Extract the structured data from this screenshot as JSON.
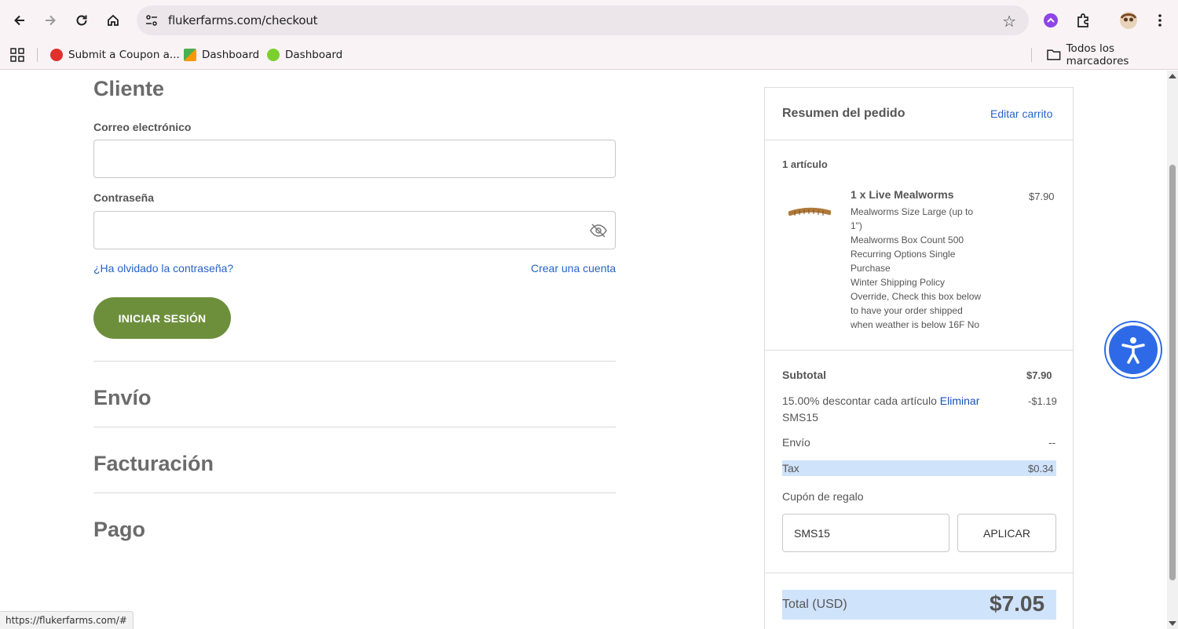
{
  "browser": {
    "url": "flukerfarms.com/checkout",
    "bookmarks": [
      "Submit a Coupon a...",
      "Dashboard",
      "Dashboard"
    ],
    "all_bookmarks": "Todos los marcadores",
    "status_url": "https://flukerfarms.com/#"
  },
  "customer": {
    "heading": "Cliente",
    "email_label": "Correo electrónico",
    "password_label": "Contraseña",
    "forgot_link": "¿Ha olvidado la contraseña?",
    "create_link": "Crear una cuenta",
    "login_button": "INICIAR SESIÓN"
  },
  "sections": {
    "shipping": "Envío",
    "billing": "Facturación",
    "payment": "Pago"
  },
  "summary": {
    "title": "Resumen del pedido",
    "edit_cart": "Editar carrito",
    "item_count": "1 artículo",
    "item": {
      "name": "1 x Live Mealworms",
      "price": "$7.90",
      "details": [
        "Mealworms Size Large (up to",
        "1\")",
        "Mealworms Box Count 500",
        "Recurring Options Single",
        "Purchase",
        "Winter Shipping Policy",
        "Override, Check this box below",
        "to have your order shipped",
        "when weather is below 16F No"
      ]
    },
    "subtotal_label": "Subtotal",
    "subtotal_value": "$7.90",
    "discount_label": "15.00% descontar cada artículo",
    "discount_remove": "Eliminar",
    "discount_code": "SMS15",
    "discount_value": "-$1.19",
    "shipping_label": "Envío",
    "shipping_value": "--",
    "tax_label": "Tax",
    "tax_value": "$0.34",
    "gift_label": "Cupón de regalo",
    "coupon_value": "SMS15",
    "apply_button": "APLICAR",
    "total_label": "Total (USD)",
    "total_value": "$7.05"
  },
  "colors": {
    "accent_green": "#6d8f3c",
    "link_blue": "#2763c7",
    "a11y_blue": "#2e6ae8",
    "highlight": "#cfe3fb"
  }
}
